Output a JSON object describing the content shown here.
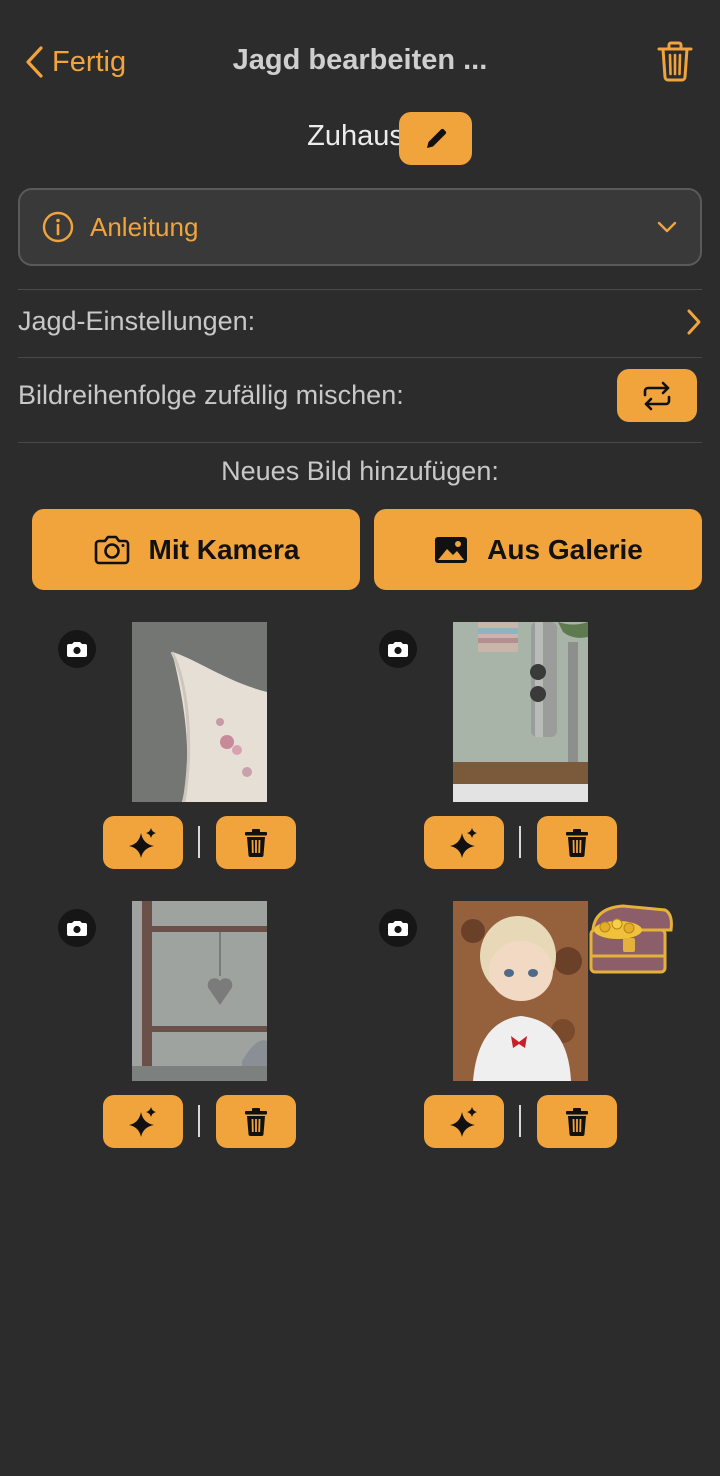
{
  "header": {
    "back_label": "Fertig",
    "title": "Jagd bearbeiten ...",
    "hunt_name": "Zuhause"
  },
  "instructions": {
    "label": "Anleitung"
  },
  "settings": {
    "hunt_settings_label": "Jagd-Einstellungen:",
    "shuffle_label": "Bildreihenfolge zufällig mischen:"
  },
  "add_image": {
    "label": "Neues Bild hinzufügen:",
    "camera_label": "Mit Kamera",
    "gallery_label": "Aus Galerie"
  },
  "images": [
    {
      "subject": "pillow",
      "source_icon": "camera-icon",
      "has_treasure": false
    },
    {
      "subject": "kitchen faucet",
      "source_icon": "camera-icon",
      "has_treasure": false
    },
    {
      "subject": "ladder with heart",
      "source_icon": "camera-icon",
      "has_treasure": false
    },
    {
      "subject": "doll",
      "source_icon": "camera-icon",
      "has_treasure": true
    }
  ],
  "colors": {
    "background": "#2c2c2c",
    "accent": "#f1a33c",
    "card": "#393939"
  }
}
